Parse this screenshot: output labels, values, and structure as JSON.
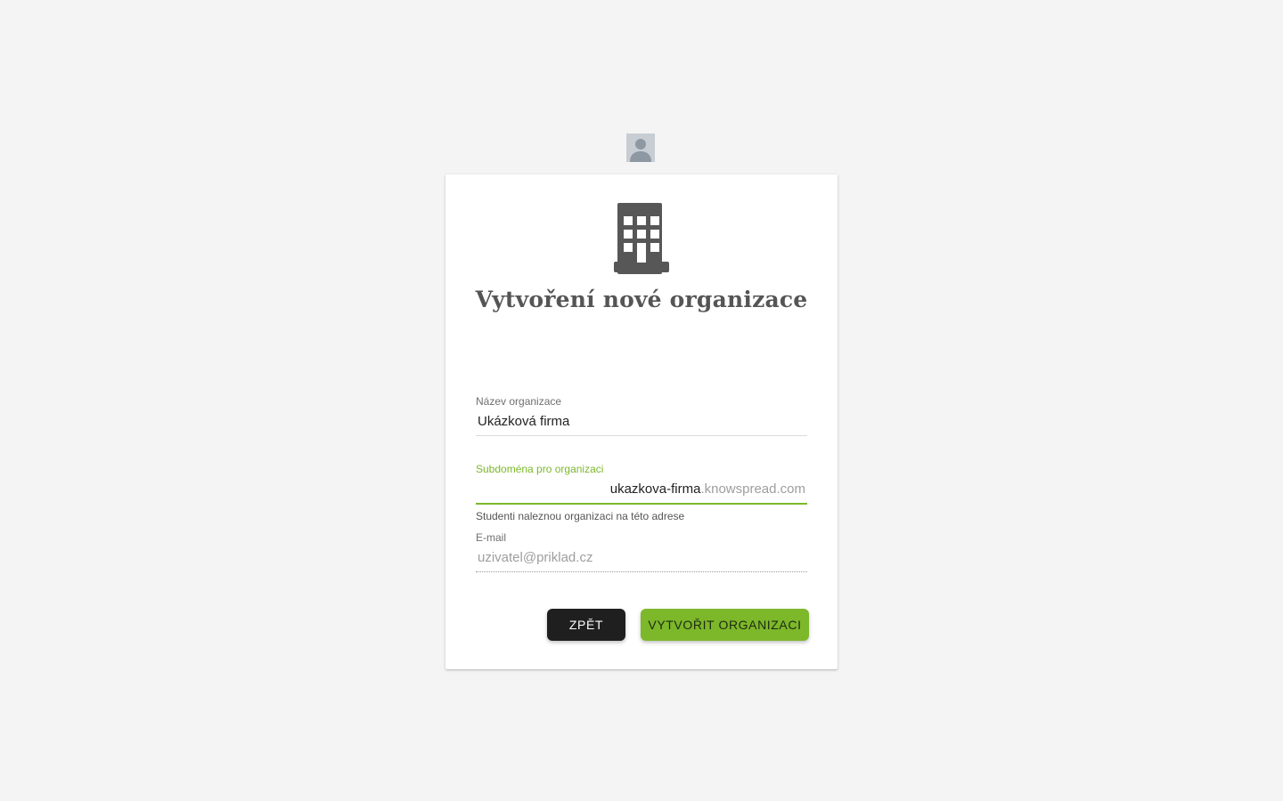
{
  "header": {
    "avatar_icon": "user-avatar-icon"
  },
  "card": {
    "icon": "building-icon",
    "title": "Vytvoření nové organizace"
  },
  "form": {
    "org_name": {
      "label": "Název organizace",
      "value": "Ukázková firma"
    },
    "subdomain": {
      "label": "Subdoména pro organizaci",
      "value": "ukazkova-firma",
      "suffix": ".knowspread.com",
      "helper": "Studenti naleznou organizaci na této adrese"
    },
    "email": {
      "label": "E-mail",
      "placeholder": "uzivatel@priklad.cz"
    }
  },
  "actions": {
    "back_label": "ZPĚT",
    "create_label": "VYTVOŘIT ORGANIZACI"
  },
  "colors": {
    "accent": "#7cb82a",
    "dark_button": "#1f1f1f",
    "background": "#f4f4f4"
  }
}
